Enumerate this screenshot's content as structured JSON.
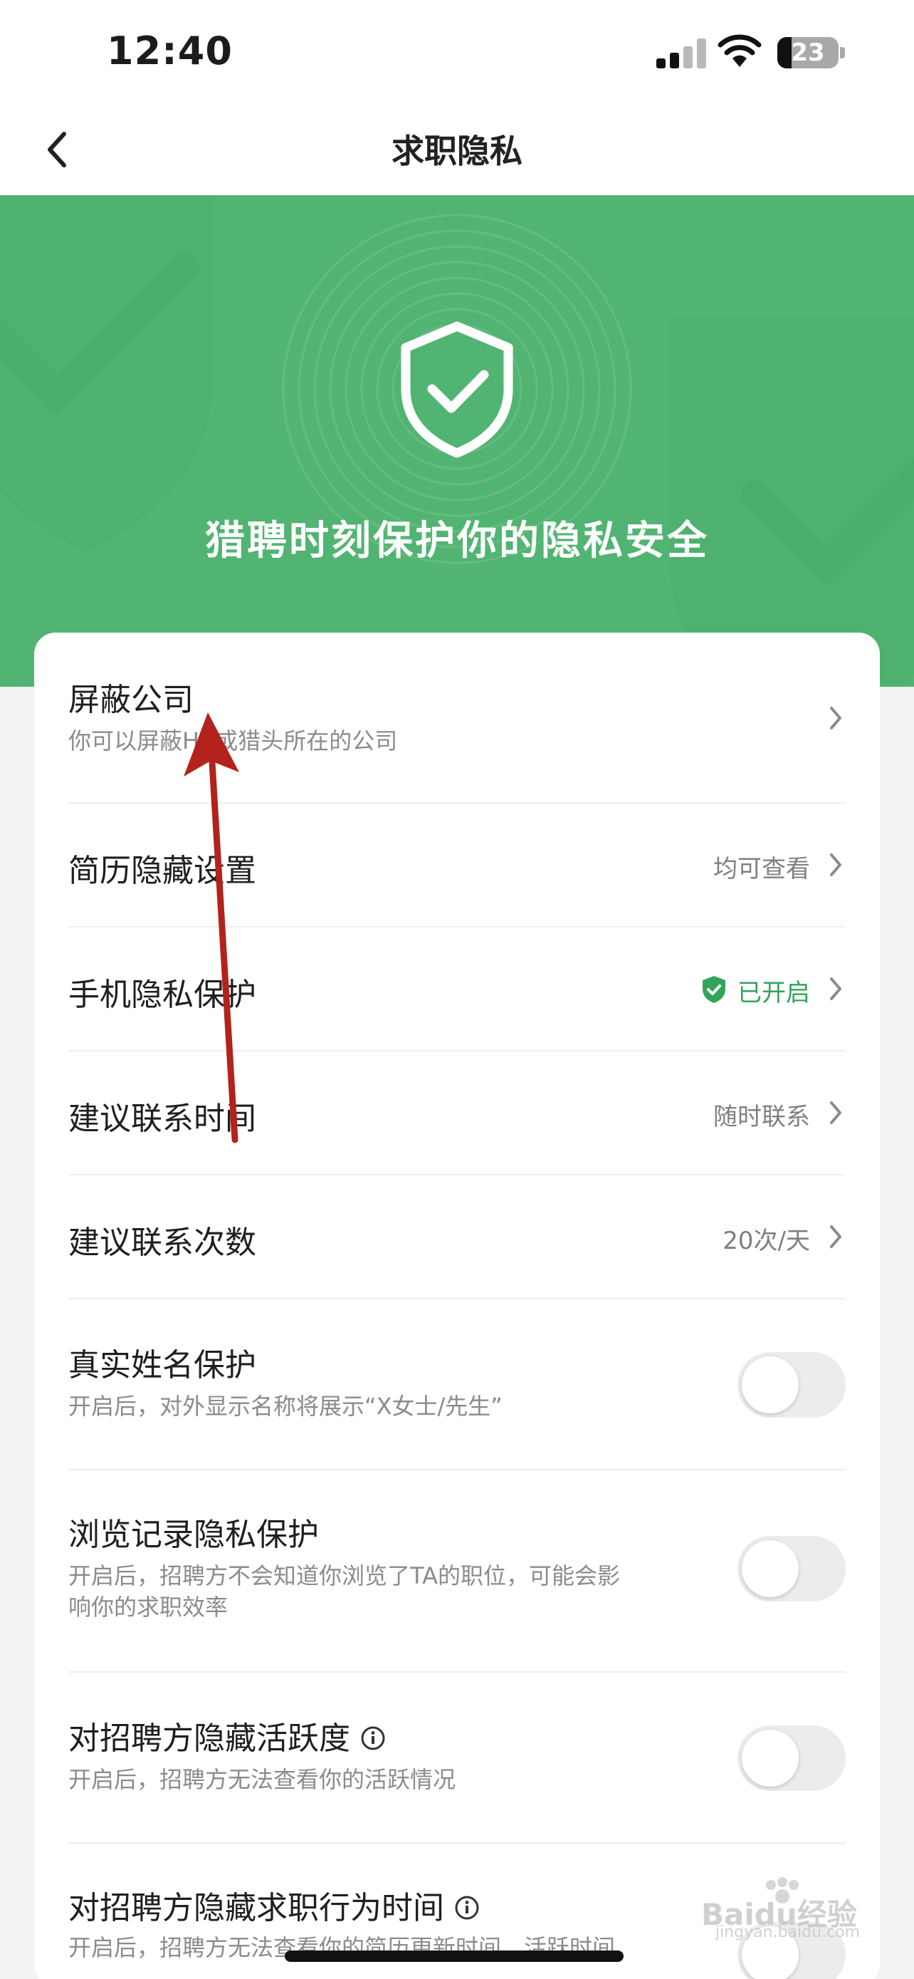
{
  "status_bar": {
    "time": "12:40",
    "battery_level": "23",
    "battery_fraction": 0.23
  },
  "nav": {
    "title": "求职隐私",
    "back_icon": "chevron-left-icon"
  },
  "hero": {
    "title": "猎聘时刻保护你的隐私安全",
    "icon": "shield-check-icon"
  },
  "settings": {
    "block_company": {
      "title": "屏蔽公司",
      "subtitle": "你可以屏蔽HR或猎头所在的公司"
    },
    "resume_hide": {
      "title": "简历隐藏设置",
      "value": "均可查看"
    },
    "phone_privacy": {
      "title": "手机隐私保护",
      "value": "已开启"
    },
    "contact_time": {
      "title": "建议联系时间",
      "value": "随时联系"
    },
    "contact_count": {
      "title": "建议联系次数",
      "value": "20次/天"
    },
    "real_name": {
      "title": "真实姓名保护",
      "subtitle": "开启后，对外显示名称将展示“X女士/先生”",
      "enabled": false
    },
    "browse_history": {
      "title": "浏览记录隐私保护",
      "subtitle_line1": "开启后，招聘方不会知道你浏览了TA的职位，可能会影",
      "subtitle_line2": "响你的求职效率",
      "enabled": false
    },
    "hide_activity": {
      "title": "对招聘方隐藏活跃度",
      "subtitle": "开启后，招聘方无法查看你的活跃情况",
      "enabled": false
    },
    "hide_behavior_time": {
      "title": "对招聘方隐藏求职行为时间",
      "subtitle": "开启后，招聘方无法查看你的简历更新时间、活跃时间",
      "enabled": false
    }
  },
  "watermark": {
    "text": "Baidu经验",
    "url_text": "jingyan.baidu.com"
  },
  "colors": {
    "brand_green": "#52b472",
    "on_green": "#33a35a",
    "arrow_red": "#b3221c"
  }
}
